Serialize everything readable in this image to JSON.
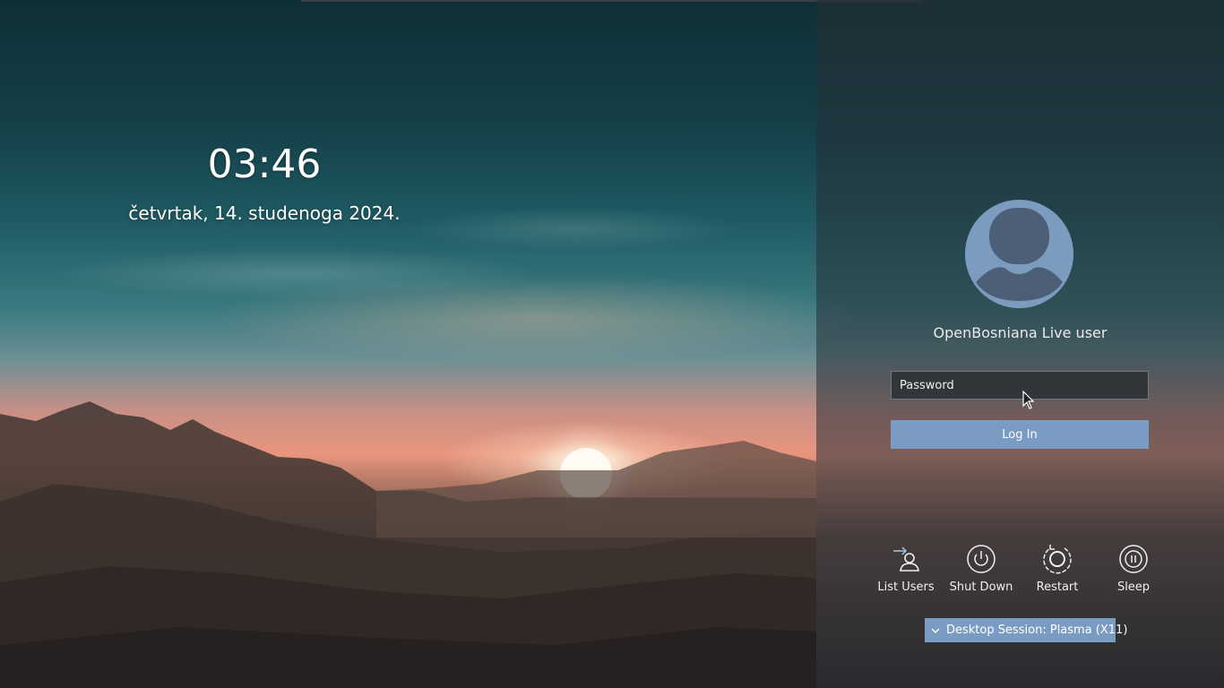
{
  "lockscreen": {
    "time": "03:46",
    "date": "četvrtak, 14. studenoga 2024."
  },
  "login": {
    "username": "OpenBosniana Live user",
    "password_placeholder": "Password",
    "password_value": "",
    "login_label": "Log In"
  },
  "actions": [
    {
      "label": "List Users",
      "icon": "list-users-icon"
    },
    {
      "label": "Shut Down",
      "icon": "power-icon"
    },
    {
      "label": "Restart",
      "icon": "restart-icon"
    },
    {
      "label": "Sleep",
      "icon": "sleep-icon"
    }
  ],
  "session": {
    "label": "Desktop Session: Plasma (X11)"
  },
  "colors": {
    "accent": "#7b9cc2",
    "field_background": "#31363b",
    "text": "#eff0f1"
  }
}
